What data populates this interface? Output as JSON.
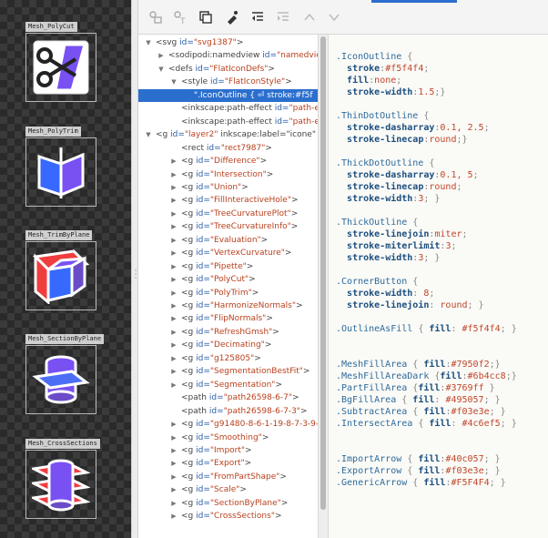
{
  "canvas": {
    "icons": [
      {
        "label": "Mesh_PolyCut",
        "glyph": "scissors-icon"
      },
      {
        "label": "Mesh_PolyTrim",
        "glyph": "polytrim-icon"
      },
      {
        "label": "Mesh_TrimByPlane",
        "glyph": "cube-plane-icon"
      },
      {
        "label": "Mesh_SectionByPlane",
        "glyph": "cylinder-plane-icon"
      },
      {
        "label": "Mesh_CrossSections",
        "glyph": "cylinder-sections-icon"
      }
    ]
  },
  "toolbar": {
    "buttons": [
      "new-element-node-icon",
      "new-text-node-icon",
      "duplicate-node-icon",
      "delete-node-icon",
      "unindent-node-icon",
      "indent-node-icon",
      "raise-node-icon",
      "lower-node-icon"
    ]
  },
  "tree": {
    "nodes": [
      {
        "arrow": "down",
        "indent": 0,
        "tag": "<svg",
        "attr": " id=",
        "val": "\"svg1387\"",
        "rest": ">"
      },
      {
        "arrow": "right",
        "indent": 1,
        "tag": "<sodipodi:namedview",
        "attr": " id=",
        "val": "\"namedview",
        "rest": ""
      },
      {
        "arrow": "down",
        "indent": 1,
        "tag": "<defs",
        "attr": " id=",
        "val": "\"FlatIconDefs\"",
        "rest": ">"
      },
      {
        "arrow": "down",
        "indent": 2,
        "tag": "<style",
        "attr": " id=",
        "val": "\"FlatIconStyle\"",
        "rest": ">"
      },
      {
        "arrow": "",
        "indent": 3,
        "tag": "\".IconOutline {",
        "attr": "  ⏎  ",
        "val": "stroke:#f5f",
        "rest": "",
        "selected": true
      },
      {
        "arrow": "",
        "indent": 2,
        "tag": "<inkscape:path-effect",
        "attr": " id=",
        "val": "\"path-eff",
        "rest": ""
      },
      {
        "arrow": "",
        "indent": 2,
        "tag": "<inkscape:path-effect",
        "attr": " id=",
        "val": "\"path-eff",
        "rest": ""
      },
      {
        "arrow": "down",
        "indent": 0,
        "tag": "<g",
        "attr": " id=",
        "val": "\"layer2\"",
        "rest": " inkscape:label=\"icone\""
      },
      {
        "arrow": "",
        "indent": 2,
        "tag": "<rect",
        "attr": " id=",
        "val": "\"rect7987\"",
        "rest": ">"
      },
      {
        "arrow": "right",
        "indent": 2,
        "tag": "<g",
        "attr": " id=",
        "val": "\"Difference\"",
        "rest": ">"
      },
      {
        "arrow": "right",
        "indent": 2,
        "tag": "<g",
        "attr": " id=",
        "val": "\"Intersection\"",
        "rest": ">"
      },
      {
        "arrow": "right",
        "indent": 2,
        "tag": "<g",
        "attr": " id=",
        "val": "\"Union\"",
        "rest": ">"
      },
      {
        "arrow": "right",
        "indent": 2,
        "tag": "<g",
        "attr": " id=",
        "val": "\"FillInteractiveHole\"",
        "rest": ">"
      },
      {
        "arrow": "right",
        "indent": 2,
        "tag": "<g",
        "attr": " id=",
        "val": "\"TreeCurvaturePlot\"",
        "rest": ">"
      },
      {
        "arrow": "right",
        "indent": 2,
        "tag": "<g",
        "attr": " id=",
        "val": "\"TreeCurvatureInfo\"",
        "rest": ">"
      },
      {
        "arrow": "right",
        "indent": 2,
        "tag": "<g",
        "attr": " id=",
        "val": "\"Evaluation\"",
        "rest": ">"
      },
      {
        "arrow": "right",
        "indent": 2,
        "tag": "<g",
        "attr": " id=",
        "val": "\"VertexCurvature\"",
        "rest": ">"
      },
      {
        "arrow": "right",
        "indent": 2,
        "tag": "<g",
        "attr": " id=",
        "val": "\"Pipette\"",
        "rest": ">"
      },
      {
        "arrow": "right",
        "indent": 2,
        "tag": "<g",
        "attr": " id=",
        "val": "\"PolyCut\"",
        "rest": ">"
      },
      {
        "arrow": "right",
        "indent": 2,
        "tag": "<g",
        "attr": " id=",
        "val": "\"PolyTrim\"",
        "rest": ">"
      },
      {
        "arrow": "right",
        "indent": 2,
        "tag": "<g",
        "attr": " id=",
        "val": "\"HarmonizeNormals\"",
        "rest": ">"
      },
      {
        "arrow": "right",
        "indent": 2,
        "tag": "<g",
        "attr": " id=",
        "val": "\"FlipNormals\"",
        "rest": ">"
      },
      {
        "arrow": "right",
        "indent": 2,
        "tag": "<g",
        "attr": " id=",
        "val": "\"RefreshGmsh\"",
        "rest": ">"
      },
      {
        "arrow": "right",
        "indent": 2,
        "tag": "<g",
        "attr": " id=",
        "val": "\"Decimating\"",
        "rest": ">"
      },
      {
        "arrow": "right",
        "indent": 2,
        "tag": "<g",
        "attr": " id=",
        "val": "\"g125805\"",
        "rest": ">"
      },
      {
        "arrow": "right",
        "indent": 2,
        "tag": "<g",
        "attr": " id=",
        "val": "\"SegmentationBestFit\"",
        "rest": ">"
      },
      {
        "arrow": "right",
        "indent": 2,
        "tag": "<g",
        "attr": " id=",
        "val": "\"Segmentation\"",
        "rest": ">"
      },
      {
        "arrow": "",
        "indent": 2,
        "tag": "<path",
        "attr": " id=",
        "val": "\"path26598-6-7\"",
        "rest": ">"
      },
      {
        "arrow": "",
        "indent": 2,
        "tag": "<path",
        "attr": " id=",
        "val": "\"path26598-6-7-3\"",
        "rest": ">"
      },
      {
        "arrow": "right",
        "indent": 2,
        "tag": "<g",
        "attr": " id=",
        "val": "\"g91480-8-6-1-19-8-7-3-9-6",
        "rest": ""
      },
      {
        "arrow": "right",
        "indent": 2,
        "tag": "<g",
        "attr": " id=",
        "val": "\"Smoothing\"",
        "rest": ">"
      },
      {
        "arrow": "right",
        "indent": 2,
        "tag": "<g",
        "attr": " id=",
        "val": "\"Import\"",
        "rest": ">"
      },
      {
        "arrow": "right",
        "indent": 2,
        "tag": "<g",
        "attr": " id=",
        "val": "\"Export\"",
        "rest": ">"
      },
      {
        "arrow": "right",
        "indent": 2,
        "tag": "<g",
        "attr": " id=",
        "val": "\"FromPartShape\"",
        "rest": ">"
      },
      {
        "arrow": "right",
        "indent": 2,
        "tag": "<g",
        "attr": " id=",
        "val": "\"Scale\"",
        "rest": ">"
      },
      {
        "arrow": "right",
        "indent": 2,
        "tag": "<g",
        "attr": " id=",
        "val": "\"SectionByPlane\"",
        "rest": ">"
      },
      {
        "arrow": "right",
        "indent": 2,
        "tag": "<g",
        "attr": " id=",
        "val": "\"CrossSections\"",
        "rest": ">"
      }
    ]
  },
  "editor": {
    "lines": [
      [
        {
          "c": "sel-c",
          "t": ".IconOutline "
        },
        {
          "c": "punc",
          "t": "{"
        }
      ],
      [
        {
          "c": "",
          "t": "  "
        },
        {
          "c": "prop",
          "t": "stroke"
        },
        {
          "c": "punc",
          "t": ":"
        },
        {
          "c": "pval",
          "t": "#f5f4f4"
        },
        {
          "c": "punc",
          "t": ";"
        }
      ],
      [
        {
          "c": "",
          "t": "  "
        },
        {
          "c": "prop",
          "t": "fill"
        },
        {
          "c": "punc",
          "t": ":"
        },
        {
          "c": "pval",
          "t": "none"
        },
        {
          "c": "punc",
          "t": ";"
        }
      ],
      [
        {
          "c": "",
          "t": "  "
        },
        {
          "c": "prop",
          "t": "stroke-width"
        },
        {
          "c": "punc",
          "t": ":"
        },
        {
          "c": "pval",
          "t": "1.5"
        },
        {
          "c": "punc",
          "t": ";}"
        }
      ],
      [],
      [
        {
          "c": "sel-c",
          "t": ".ThinDotOutline "
        },
        {
          "c": "punc",
          "t": "{"
        }
      ],
      [
        {
          "c": "",
          "t": "  "
        },
        {
          "c": "prop",
          "t": "stroke-dasharray"
        },
        {
          "c": "punc",
          "t": ":"
        },
        {
          "c": "pval",
          "t": "0.1, 2.5"
        },
        {
          "c": "punc",
          "t": ";"
        }
      ],
      [
        {
          "c": "",
          "t": "  "
        },
        {
          "c": "prop",
          "t": "stroke-linecap"
        },
        {
          "c": "punc",
          "t": ":"
        },
        {
          "c": "pval",
          "t": "round"
        },
        {
          "c": "punc",
          "t": ";}"
        }
      ],
      [],
      [
        {
          "c": "sel-c",
          "t": ".ThickDotOutline "
        },
        {
          "c": "punc",
          "t": "{"
        }
      ],
      [
        {
          "c": "",
          "t": "  "
        },
        {
          "c": "prop",
          "t": "stroke-dasharray"
        },
        {
          "c": "punc",
          "t": ":"
        },
        {
          "c": "pval",
          "t": "0.1, 5"
        },
        {
          "c": "punc",
          "t": ";"
        }
      ],
      [
        {
          "c": "",
          "t": "  "
        },
        {
          "c": "prop",
          "t": "stroke-linecap"
        },
        {
          "c": "punc",
          "t": ":"
        },
        {
          "c": "pval",
          "t": "round"
        },
        {
          "c": "punc",
          "t": ";"
        }
      ],
      [
        {
          "c": "",
          "t": "  "
        },
        {
          "c": "prop",
          "t": "stroke-width"
        },
        {
          "c": "punc",
          "t": ":"
        },
        {
          "c": "pval",
          "t": "3"
        },
        {
          "c": "punc",
          "t": "; }"
        }
      ],
      [],
      [
        {
          "c": "sel-c",
          "t": ".ThickOutline "
        },
        {
          "c": "punc",
          "t": "{"
        }
      ],
      [
        {
          "c": "",
          "t": "  "
        },
        {
          "c": "prop",
          "t": "stroke-linejoin"
        },
        {
          "c": "punc",
          "t": ":"
        },
        {
          "c": "pval",
          "t": "miter"
        },
        {
          "c": "punc",
          "t": ";"
        }
      ],
      [
        {
          "c": "",
          "t": "  "
        },
        {
          "c": "prop",
          "t": "stroke-miterlimit"
        },
        {
          "c": "punc",
          "t": ":"
        },
        {
          "c": "pval",
          "t": "3"
        },
        {
          "c": "punc",
          "t": ";"
        }
      ],
      [
        {
          "c": "",
          "t": "  "
        },
        {
          "c": "prop",
          "t": "stroke-width"
        },
        {
          "c": "punc",
          "t": ":"
        },
        {
          "c": "pval",
          "t": "3"
        },
        {
          "c": "punc",
          "t": "; }"
        }
      ],
      [],
      [
        {
          "c": "sel-c",
          "t": ".CornerButton "
        },
        {
          "c": "punc",
          "t": "{"
        }
      ],
      [
        {
          "c": "",
          "t": "  "
        },
        {
          "c": "prop",
          "t": "stroke-width"
        },
        {
          "c": "punc",
          "t": ": "
        },
        {
          "c": "pval",
          "t": "8"
        },
        {
          "c": "punc",
          "t": ";"
        }
      ],
      [
        {
          "c": "",
          "t": "  "
        },
        {
          "c": "prop",
          "t": "stroke-linejoin"
        },
        {
          "c": "punc",
          "t": ": "
        },
        {
          "c": "pval",
          "t": "round"
        },
        {
          "c": "punc",
          "t": "; }"
        }
      ],
      [],
      [
        {
          "c": "sel-c",
          "t": ".OutlineAsFill "
        },
        {
          "c": "punc",
          "t": "{ "
        },
        {
          "c": "prop",
          "t": "fill"
        },
        {
          "c": "punc",
          "t": ": "
        },
        {
          "c": "pval",
          "t": "#f5f4f4"
        },
        {
          "c": "punc",
          "t": "; }"
        }
      ],
      [],
      [],
      [
        {
          "c": "sel-c",
          "t": ".MeshFillArea "
        },
        {
          "c": "punc",
          "t": "{ "
        },
        {
          "c": "prop",
          "t": "fill"
        },
        {
          "c": "punc",
          "t": ":"
        },
        {
          "c": "pval",
          "t": "#7950f2"
        },
        {
          "c": "punc",
          "t": ";}"
        }
      ],
      [
        {
          "c": "sel-c",
          "t": ".MeshFillAreaDark "
        },
        {
          "c": "punc",
          "t": "{"
        },
        {
          "c": "prop",
          "t": "fill"
        },
        {
          "c": "punc",
          "t": ":"
        },
        {
          "c": "pval",
          "t": "#6b4cc8"
        },
        {
          "c": "punc",
          "t": ";}"
        }
      ],
      [
        {
          "c": "sel-c",
          "t": ".PartFillArea "
        },
        {
          "c": "punc",
          "t": "{"
        },
        {
          "c": "prop",
          "t": "fill"
        },
        {
          "c": "punc",
          "t": ":"
        },
        {
          "c": "pval",
          "t": "#3769ff"
        },
        {
          "c": "punc",
          "t": " }"
        }
      ],
      [
        {
          "c": "sel-c",
          "t": ".BgFillArea "
        },
        {
          "c": "punc",
          "t": "{ "
        },
        {
          "c": "prop",
          "t": "fill"
        },
        {
          "c": "punc",
          "t": ": "
        },
        {
          "c": "pval",
          "t": "#495057"
        },
        {
          "c": "punc",
          "t": "; }"
        }
      ],
      [
        {
          "c": "sel-c",
          "t": ".SubtractArea "
        },
        {
          "c": "punc",
          "t": "{ "
        },
        {
          "c": "prop",
          "t": "fill"
        },
        {
          "c": "punc",
          "t": ":"
        },
        {
          "c": "pval",
          "t": "#f03e3e"
        },
        {
          "c": "punc",
          "t": "; }"
        }
      ],
      [
        {
          "c": "sel-c",
          "t": ".IntersectArea "
        },
        {
          "c": "punc",
          "t": "{ "
        },
        {
          "c": "prop",
          "t": "fill"
        },
        {
          "c": "punc",
          "t": ": "
        },
        {
          "c": "pval",
          "t": "#4c6ef5"
        },
        {
          "c": "punc",
          "t": "; }"
        }
      ],
      [],
      [],
      [
        {
          "c": "sel-c",
          "t": ".ImportArrow "
        },
        {
          "c": "punc",
          "t": "{ "
        },
        {
          "c": "prop",
          "t": "fill"
        },
        {
          "c": "punc",
          "t": ":"
        },
        {
          "c": "pval",
          "t": "#40c057"
        },
        {
          "c": "punc",
          "t": "; }"
        }
      ],
      [
        {
          "c": "sel-c",
          "t": ".ExportArrow "
        },
        {
          "c": "punc",
          "t": "{ "
        },
        {
          "c": "prop",
          "t": "fill"
        },
        {
          "c": "punc",
          "t": ":"
        },
        {
          "c": "pval",
          "t": "#f03e3e"
        },
        {
          "c": "punc",
          "t": "; }"
        }
      ],
      [
        {
          "c": "sel-c",
          "t": ".GenericArrow "
        },
        {
          "c": "punc",
          "t": "{ "
        },
        {
          "c": "prop",
          "t": "fill"
        },
        {
          "c": "punc",
          "t": ":"
        },
        {
          "c": "pval",
          "t": "#F5F4F4"
        },
        {
          "c": "punc",
          "t": "; }"
        }
      ]
    ]
  }
}
